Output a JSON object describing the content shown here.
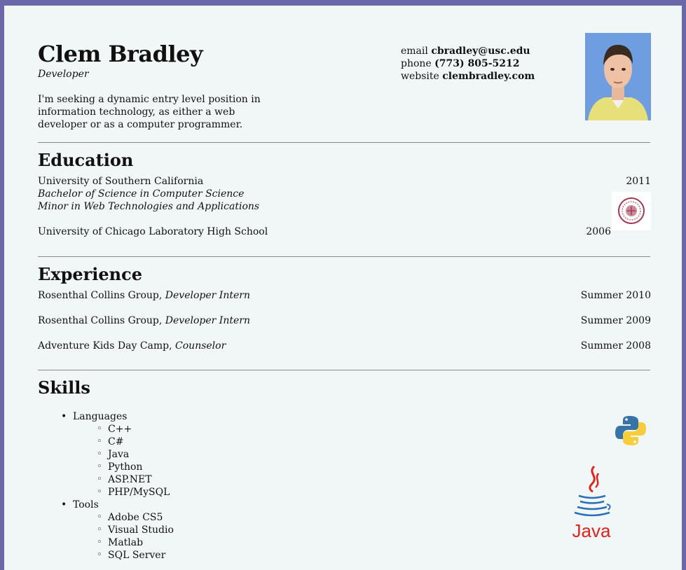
{
  "header": {
    "name": "Clem Bradley",
    "title": "Developer",
    "objective": "I'm seeking a dynamic entry level position in information technology, as either a web developer or as a computer programmer."
  },
  "contact": {
    "email_label": "email",
    "email": "cbradley@usc.edu",
    "phone_label": "phone",
    "phone": "(773) 805-5212",
    "website_label": "website",
    "website": "clembradley.com"
  },
  "education": {
    "heading": "Education",
    "items": [
      {
        "school": "University of Southern California",
        "line2": "Bachelor of Science in Computer Science",
        "line3": "Minor in Web Technologies and Applications",
        "year": "2011"
      },
      {
        "school": "University of Chicago Laboratory High School",
        "year": "2006"
      }
    ]
  },
  "experience": {
    "heading": "Experience",
    "items": [
      {
        "org": "Rosenthal Collins Group,",
        "role": "Developer Intern",
        "date": "Summer 2010"
      },
      {
        "org": "Rosenthal Collins Group,",
        "role": "Developer Intern",
        "date": "Summer 2009"
      },
      {
        "org": "Adventure Kids Day Camp,",
        "role": "Counselor",
        "date": "Summer 2008"
      }
    ]
  },
  "skills": {
    "heading": "Skills",
    "languages_label": "Languages",
    "languages": [
      "C++",
      "C#",
      "Java",
      "Python",
      "ASP.NET",
      "PHP/MySQL"
    ],
    "tools_label": "Tools",
    "tools": [
      "Adobe CS5",
      "Visual Studio",
      "Matlab",
      "SQL Server"
    ]
  },
  "logos": {
    "java_text": "Java"
  },
  "colors": {
    "frame": "#6a68a8",
    "page": "#f0f7f6",
    "java_red": "#e0231c",
    "java_blue": "#2a6fb8",
    "python_blue": "#3873a8",
    "python_yellow": "#f7cd3c"
  }
}
